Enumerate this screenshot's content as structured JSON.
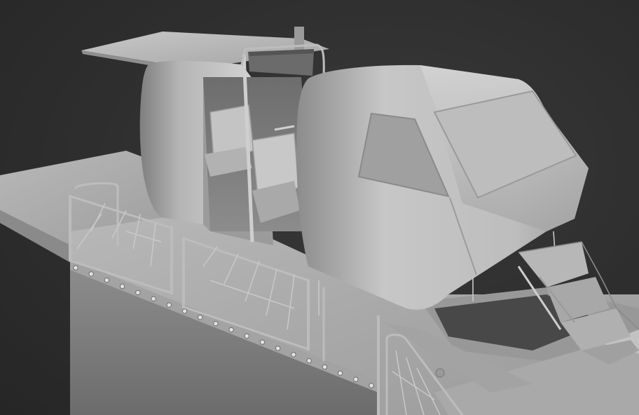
{
  "scene": {
    "subject": "gondola-cabin-station",
    "colors": {
      "background": "#2b2b2b",
      "model_light": "#dcdcdc",
      "model_mid": "#a8a8a8",
      "model_dark": "#6a6a6a"
    }
  }
}
